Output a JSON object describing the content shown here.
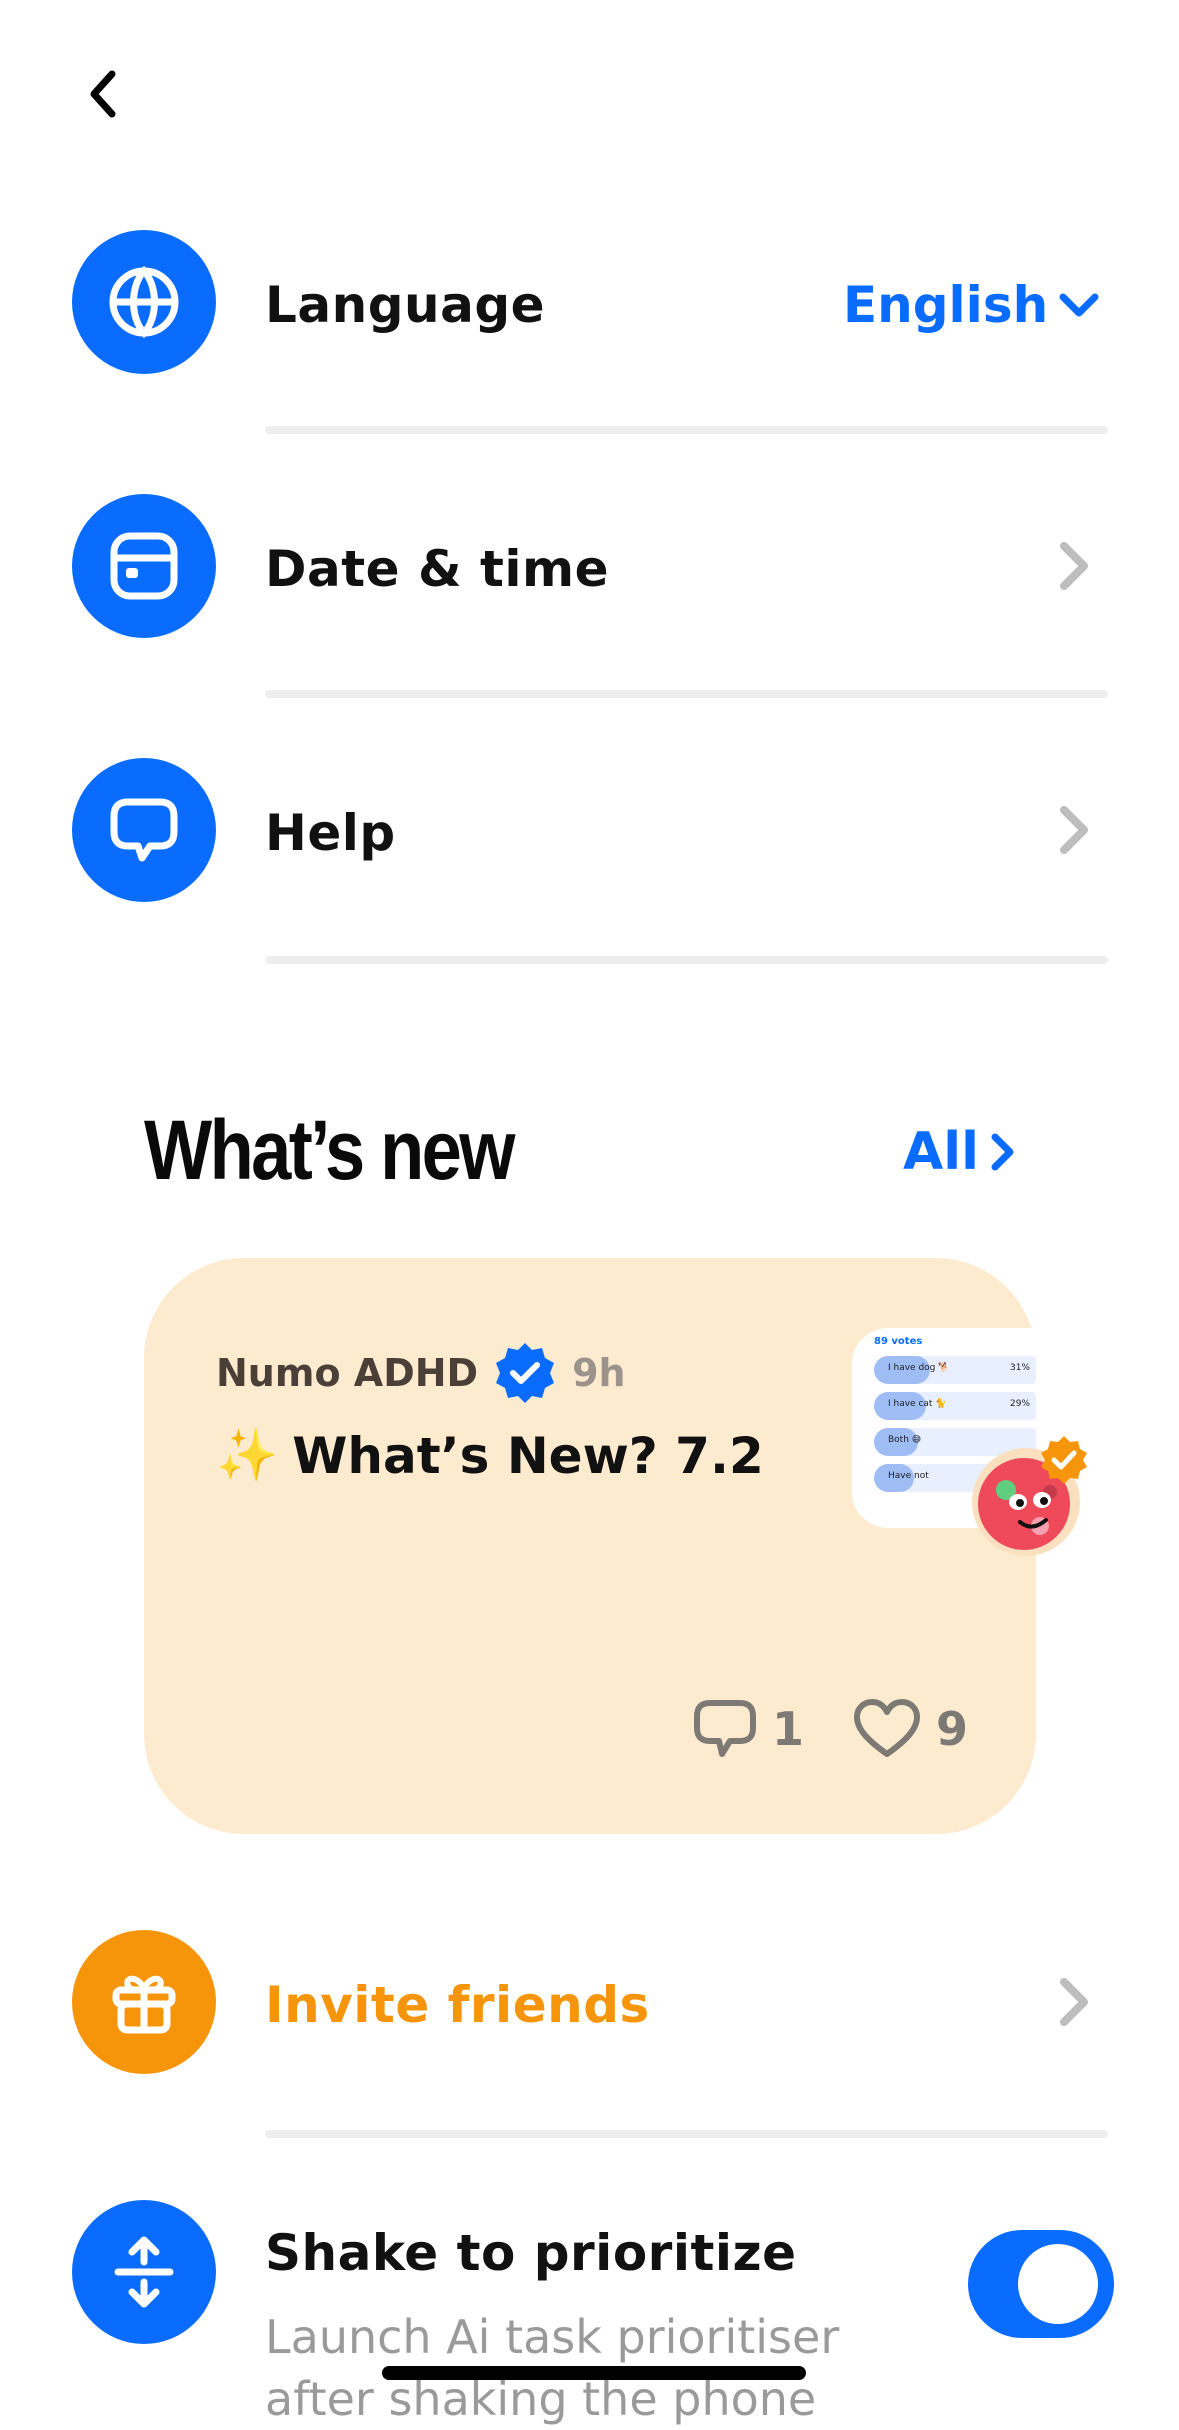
{
  "colors": {
    "accent": "#0a6cff",
    "invite": "#f7950a",
    "card_bg": "#fdebd0"
  },
  "header": {
    "back_icon": "chevron-left-icon"
  },
  "settings": {
    "language": {
      "label": "Language",
      "value": "English",
      "icon": "globe-icon"
    },
    "date_time": {
      "label": "Date & time",
      "icon": "calendar-icon"
    },
    "help": {
      "label": "Help",
      "icon": "speech-bubble-icon"
    }
  },
  "whats_new": {
    "title": "What’s new",
    "all_label": "All",
    "card": {
      "author": "Numo ADHD",
      "time": "9h",
      "emoji": "✨",
      "title": "What’s New? 7.2",
      "comments": "1",
      "likes": "9",
      "thumbnail": {
        "votes": "89 votes",
        "options": [
          {
            "label": "I have dog 🐕",
            "pct": "31%"
          },
          {
            "label": "I have cat 🐈",
            "pct": "29%"
          },
          {
            "label": "Both 😅",
            "pct": ""
          },
          {
            "label": "Have not",
            "pct": ""
          }
        ]
      }
    }
  },
  "invite": {
    "label": "Invite friends",
    "icon": "gift-icon"
  },
  "shake": {
    "label": "Shake to prioritize",
    "subtitle": "Launch Ai task prioritiser after shaking the phone",
    "enabled": true,
    "icon": "shake-arrows-icon"
  }
}
